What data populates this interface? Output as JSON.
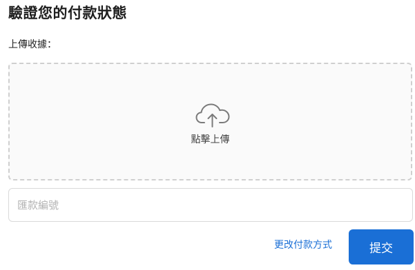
{
  "header": {
    "title": "驗證您的付款狀態"
  },
  "receipt": {
    "label": "上傳收據：",
    "upload_text": "點擊上傳",
    "icon": "cloud-upload-icon"
  },
  "reference": {
    "placeholder": "匯款編號",
    "value": ""
  },
  "actions": {
    "change_method_label": "更改付款方式",
    "submit_label": "提交"
  },
  "colors": {
    "accent": "#1a6fd6",
    "dashed_border": "#cfcfcf",
    "upload_background": "#fafafa"
  }
}
